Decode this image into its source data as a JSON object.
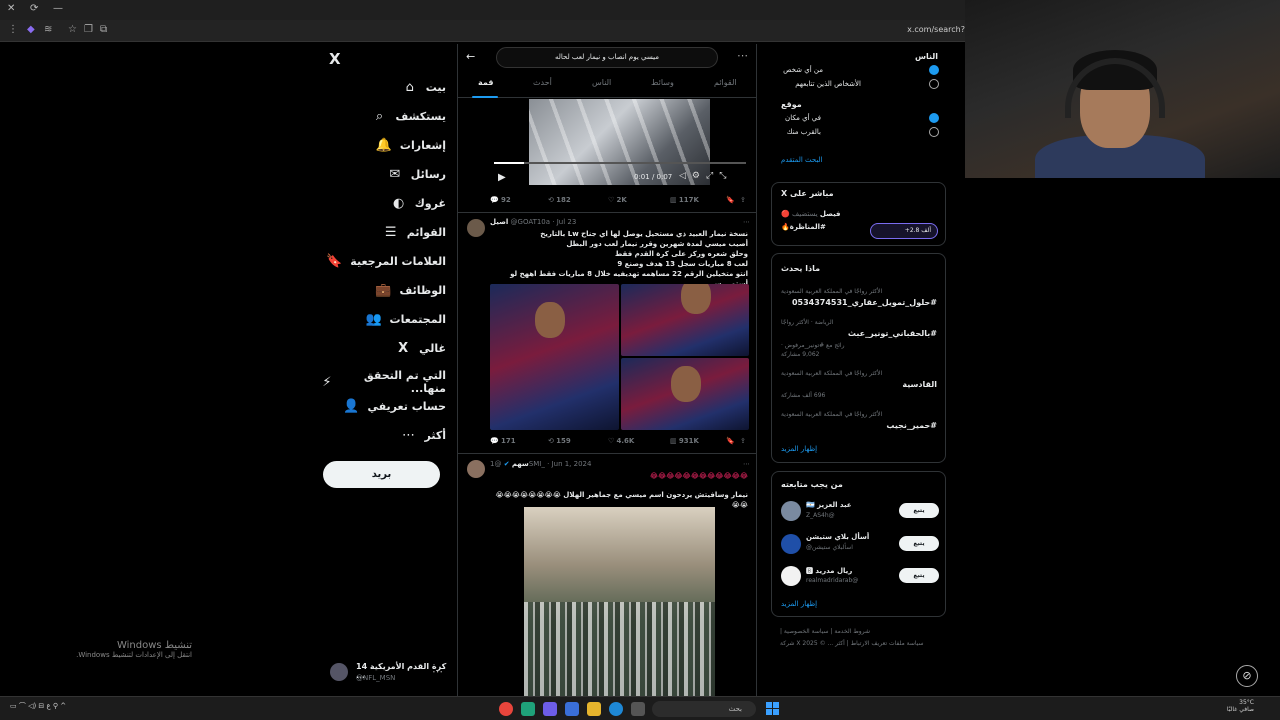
{
  "browser": {
    "url": "x.com/search?",
    "controls": [
      "✕",
      "⟳",
      "—"
    ]
  },
  "nav": {
    "logo": "X",
    "items": [
      {
        "label": "بيت",
        "icon": "⌂",
        "name": "home"
      },
      {
        "label": "يستكشف",
        "icon": "⌕",
        "name": "explore"
      },
      {
        "label": "إشعارات",
        "icon": "🔔",
        "name": "notifications"
      },
      {
        "label": "رسائل",
        "icon": "✉",
        "name": "messages"
      },
      {
        "label": "غروك",
        "icon": "◐",
        "name": "grok"
      },
      {
        "label": "القوائم",
        "icon": "☰",
        "name": "lists"
      },
      {
        "label": "العلامات المرجعية",
        "icon": "🔖",
        "name": "bookmarks"
      },
      {
        "label": "الوظائف",
        "icon": "💼",
        "name": "jobs"
      },
      {
        "label": "المجتمعات",
        "icon": "👥",
        "name": "communities"
      },
      {
        "label": "غالي",
        "icon": "X",
        "name": "premium"
      },
      {
        "label": "التي تم التحقق منها...",
        "icon": "⚡",
        "name": "verified-orgs"
      },
      {
        "label": "حساب تعريفي",
        "icon": "👤",
        "name": "profile"
      },
      {
        "label": "أكثر",
        "icon": "⋯",
        "name": "more"
      }
    ],
    "post_label": "بريد",
    "account": {
      "name": "كرة القدم الأمريكية 14 ...",
      "handle": "@NFL_MSN"
    }
  },
  "search": {
    "query": "ميسي يوم انصاب و نيمار لعب لحاله",
    "tabs": [
      "قمة",
      "أحدث",
      "الناس",
      "وسائط",
      "القوائم"
    ]
  },
  "video1": {
    "time": "0:01 / 0:07",
    "actions": [
      "92",
      "182",
      "2K",
      "117K"
    ]
  },
  "tweet2": {
    "name": "اصيل",
    "handle": "@GOAT10a",
    "date": "Jul 23",
    "lines": [
      "نسخة نيمار العبيد ذي مستحيل يوصل لها اي جناح Lw بالتاريخ",
      "أصيب ميسي لمدة شهرين وقرر نيمار لعب دور البطل",
      "وحلق شعره وركز على كرة القدم فقط",
      "لعب 8 مباريات سجل 13 هدف وصنع 9",
      "انتو متخيلين الرقم 22 مساهمه تهديفيه خلال 8 مباريات فقط اههخ لو أستمر بس"
    ],
    "actions": [
      "171",
      "159",
      "4.6K",
      "931K"
    ]
  },
  "tweet3": {
    "name": "سهم",
    "handle": "@1SMI_",
    "date": "Jun 1, 2024",
    "emoji_line": "😂😂😂😂😂😂😂😂😂😂😂😂",
    "text": "نيمار وسافيتش يردحون اسم ميسي مع جماهير الهلال 😭😭😭😭😭😭😭😭😭😭"
  },
  "filters": {
    "people_title": "الناس",
    "people_options": [
      "من أي شخص",
      "الأشخاص الذين تتابعهم"
    ],
    "location_title": "موقع",
    "location_options": [
      "في أي مكان",
      "بالقرب منك"
    ],
    "advanced": "البحث المتقدم"
  },
  "live": {
    "title": "مباشر على X",
    "host": "فيصل",
    "host_note": "يستضيف",
    "topic": "#المناظرة🔥",
    "listeners": "+2.8 ألف"
  },
  "trends": {
    "title": "ماذا يحدث",
    "items": [
      {
        "meta": "الأكثر رواجًا في المملكة العربية السعودية",
        "name": "#حلول_تمويل_عقاري_0534374531",
        "extra": ""
      },
      {
        "meta": "الرياضة · الأكثر رواجًا",
        "name": "#بالحقباني_تونير_عبث",
        "extra": "رائج مع #تونير_مرفوض · 9,062 مشاركة"
      },
      {
        "meta": "الأكثر رواجًا في المملكة العربية السعودية",
        "name": "القادسية",
        "extra": "696 ألف مشاركة"
      },
      {
        "meta": "الأكثر رواجًا في المملكة العربية السعودية",
        "name": "#حمير_نجيب",
        "extra": ""
      }
    ],
    "show_more": "إظهار المزيد"
  },
  "who_to_follow": {
    "title": "من يجب متابعته",
    "accounts": [
      {
        "name": "عبد العزيز 🇦🇷",
        "handle": "@Z_AS4h",
        "color": "#7a8aa0"
      },
      {
        "name": "أسأل بلاي ستيشن",
        "handle": "اسألبلاي ستيشن@",
        "color": "#1f4fa8"
      },
      {
        "name": "ريال مدريد 🅱",
        "handle": "@realmadridarab",
        "color": "#f2f2f2"
      }
    ],
    "follow_label": "يتبع",
    "show_more": "إظهار المزيد"
  },
  "footer": {
    "line1": "شروط الخدمة | سياسة الخصوصية |",
    "line2": "سياسة ملفات تعريف الارتباط | أكثر ... © 2025 X شركة"
  },
  "watermark": {
    "title": "تنشيط Windows",
    "subtitle": "انتقل إلى الإعدادات لتنشيط Windows."
  },
  "taskbar": {
    "search": "بحث",
    "clock": "٢:٣٣ م\n٢٧/٠٢/١٤٤٦",
    "weather": "35°C\nصافي غالبًا"
  }
}
